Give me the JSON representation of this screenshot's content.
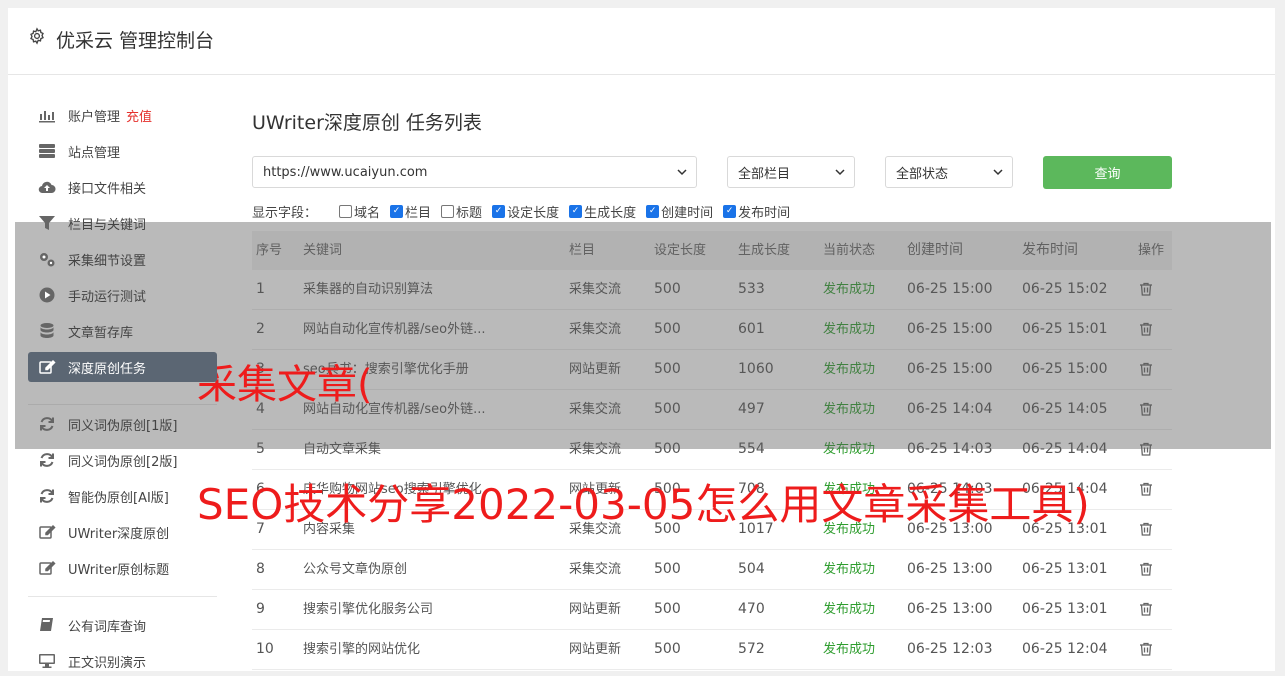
{
  "header": {
    "title": "优采云 管理控制台"
  },
  "sidebar": {
    "items": [
      {
        "label": "账户管理",
        "badge": "充值",
        "icon": "bar-chart-icon"
      },
      {
        "label": "站点管理",
        "icon": "server-icon"
      },
      {
        "label": "接口文件相关",
        "icon": "cloud-upload-icon"
      },
      {
        "label": "栏目与关键词",
        "icon": "filter-icon"
      },
      {
        "label": "采集细节设置",
        "icon": "gears-icon"
      },
      {
        "label": "手动运行测试",
        "icon": "play-circle-icon"
      },
      {
        "label": "文章暂存库",
        "icon": "database-icon"
      },
      {
        "label": "深度原创任务",
        "icon": "edit-icon"
      },
      {
        "label": "同义词伪原创[1版]",
        "icon": "refresh-icon"
      },
      {
        "label": "同义词伪原创[2版]",
        "icon": "refresh-icon"
      },
      {
        "label": "智能伪原创[AI版]",
        "icon": "refresh-icon"
      },
      {
        "label": "UWriter深度原创",
        "icon": "edit-icon"
      },
      {
        "label": "UWriter原创标题",
        "icon": "edit-icon"
      },
      {
        "label": "公有词库查询",
        "icon": "book-icon"
      },
      {
        "label": "正文识别演示",
        "icon": "monitor-icon"
      }
    ]
  },
  "main": {
    "title": "UWriter深度原创 任务列表",
    "site_select": "https://www.ucaiyun.com",
    "column_select": "全部栏目",
    "status_select": "全部状态",
    "query_label": "查询",
    "fields_label": "显示字段：",
    "fields": [
      {
        "label": "域名",
        "checked": false
      },
      {
        "label": "栏目",
        "checked": true
      },
      {
        "label": "标题",
        "checked": false
      },
      {
        "label": "设定长度",
        "checked": true
      },
      {
        "label": "生成长度",
        "checked": true
      },
      {
        "label": "创建时间",
        "checked": true
      },
      {
        "label": "发布时间",
        "checked": true
      }
    ]
  },
  "table": {
    "headers": [
      "序号",
      "关键词",
      "栏目",
      "设定长度",
      "生成长度",
      "当前状态",
      "创建时间",
      "发布时间",
      "操作"
    ],
    "rows": [
      [
        "1",
        "采集器的自动识别算法",
        "采集交流",
        "500",
        "533",
        "发布成功",
        "06-25 15:00",
        "06-25 15:02"
      ],
      [
        "2",
        "网站自动化宣传机器/seo外链...",
        "采集交流",
        "500",
        "601",
        "发布成功",
        "06-25 15:00",
        "06-25 15:01"
      ],
      [
        "3",
        "seo兵书：搜索引擎优化手册",
        "网站更新",
        "500",
        "1060",
        "发布成功",
        "06-25 15:00",
        "06-25 15:00"
      ],
      [
        "4",
        "网站自动化宣传机器/seo外链...",
        "采集交流",
        "500",
        "497",
        "发布成功",
        "06-25 14:04",
        "06-25 14:05"
      ],
      [
        "5",
        "自动文章采集",
        "采集交流",
        "500",
        "554",
        "发布成功",
        "06-25 14:03",
        "06-25 14:04"
      ],
      [
        "6",
        "庆华购物网站seo搜索引擎优化",
        "网站更新",
        "500",
        "708",
        "发布成功",
        "06-25 14:03",
        "06-25 14:04"
      ],
      [
        "7",
        "内容采集",
        "采集交流",
        "500",
        "1017",
        "发布成功",
        "06-25 13:00",
        "06-25 13:01"
      ],
      [
        "8",
        "公众号文章伪原创",
        "采集交流",
        "500",
        "504",
        "发布成功",
        "06-25 13:00",
        "06-25 13:01"
      ],
      [
        "9",
        "搜索引擎优化服务公司",
        "网站更新",
        "500",
        "470",
        "发布成功",
        "06-25 13:00",
        "06-25 13:01"
      ],
      [
        "10",
        "搜索引擎的网站优化",
        "网站更新",
        "500",
        "572",
        "发布成功",
        "06-25 12:03",
        "06-25 12:04"
      ]
    ]
  },
  "overlay": {
    "line1": "采集文章(",
    "line2": "SEO技术分享2022-03-05怎么用文章采集工具)"
  }
}
